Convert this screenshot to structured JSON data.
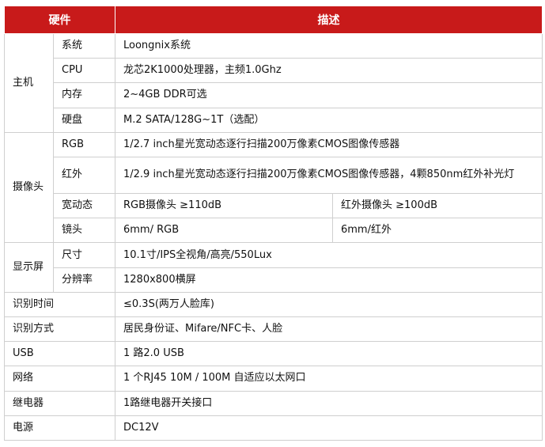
{
  "header": {
    "hardware": "硬件",
    "description": "描述"
  },
  "host": {
    "group": "主机",
    "rows": [
      {
        "name": "系统",
        "desc": "Loongnix系统"
      },
      {
        "name": "CPU",
        "desc": "龙芯2K1000处理器，主频1.0Ghz"
      },
      {
        "name": "内存",
        "desc": "2~4GB DDR可选"
      },
      {
        "name": "硬盘",
        "desc": "M.2 SATA/128G~1T（选配）"
      }
    ]
  },
  "camera": {
    "group": "摄像头",
    "rgb": {
      "name": "RGB",
      "desc": "1/2.7 inch星光宽动态逐行扫描200万像素CMOS图像传感器"
    },
    "ir": {
      "name": "红外",
      "desc": "1/2.9 inch星光宽动态逐行扫描200万像素CMOS图像传感器，4颗850nm红外补光灯"
    },
    "wdr": {
      "name": "宽动态",
      "desc_a": "RGB摄像头 ≥110dB",
      "desc_b": "红外摄像头 ≥100dB"
    },
    "lens": {
      "name": "镜头",
      "desc_a": "6mm/ RGB",
      "desc_b": "6mm/红外"
    }
  },
  "display": {
    "group": "显示屏",
    "rows": [
      {
        "name": "尺寸",
        "desc": "10.1寸/IPS全视角/高亮/550Lux"
      },
      {
        "name": "分辨率",
        "desc": "1280x800横屏"
      }
    ]
  },
  "single": [
    {
      "name": "识别时间",
      "desc": "≤0.3S(两万人脸库)"
    },
    {
      "name": "识别方式",
      "desc": "居民身份证、Mifare/NFC卡、人脸"
    },
    {
      "name": "USB",
      "desc": "1 路2.0 USB"
    },
    {
      "name": "网络",
      "desc": "1 个RJ45 10M / 100M 自适应以太网口"
    },
    {
      "name": "继电器",
      "desc": "1路继电器开关接口"
    },
    {
      "name": "电源",
      "desc": "DC12V"
    }
  ]
}
